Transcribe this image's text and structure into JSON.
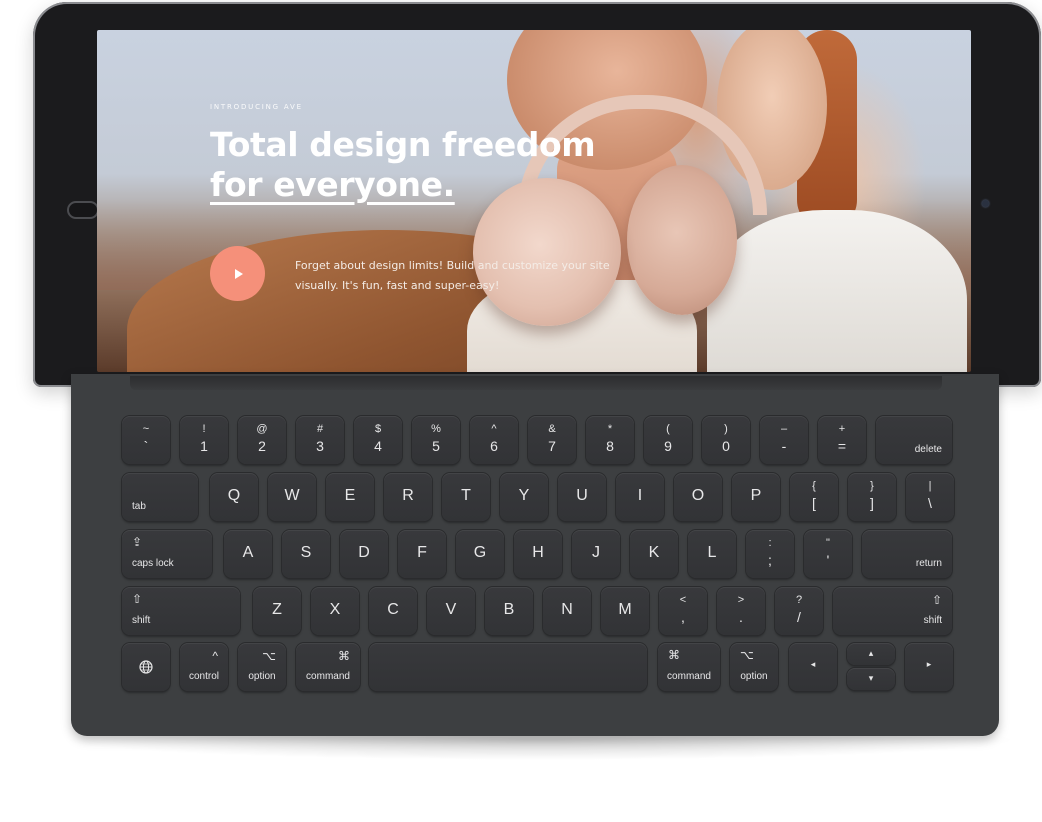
{
  "hero": {
    "eyebrow": "INTRODUCING AVE",
    "headline_line1": "Total design freedom",
    "headline_line2": "for everyone.",
    "description": "Forget about design limits! Build and customize your site visually. It's fun, fast and super-easy!",
    "play_icon": "play-icon",
    "accent_color": "#f5907a"
  },
  "keyboard": {
    "row1": [
      {
        "top": "~",
        "bottom": "`"
      },
      {
        "top": "!",
        "bottom": "1"
      },
      {
        "top": "@",
        "bottom": "2"
      },
      {
        "top": "#",
        "bottom": "3"
      },
      {
        "top": "$",
        "bottom": "4"
      },
      {
        "top": "%",
        "bottom": "5"
      },
      {
        "top": "^",
        "bottom": "6"
      },
      {
        "top": "&",
        "bottom": "7"
      },
      {
        "top": "*",
        "bottom": "8"
      },
      {
        "top": "(",
        "bottom": "9"
      },
      {
        "top": ")",
        "bottom": "0"
      },
      {
        "top": "–",
        "bottom": "-"
      },
      {
        "top": "+",
        "bottom": "="
      }
    ],
    "delete": "delete",
    "tab": "tab",
    "row2_letters": [
      "Q",
      "W",
      "E",
      "R",
      "T",
      "Y",
      "U",
      "I",
      "O",
      "P"
    ],
    "row2_symbols": [
      {
        "top": "{",
        "bottom": "["
      },
      {
        "top": "}",
        "bottom": "]"
      },
      {
        "top": "|",
        "bottom": "\\"
      }
    ],
    "caps_icon": "⇪",
    "caps_lock": "caps lock",
    "row3_letters": [
      "A",
      "S",
      "D",
      "F",
      "G",
      "H",
      "J",
      "K",
      "L"
    ],
    "row3_symbols": [
      {
        "top": ":",
        "bottom": ";"
      },
      {
        "top": "\"",
        "bottom": "'"
      }
    ],
    "return": "return",
    "shift_icon": "⇧",
    "shift": "shift",
    "row4_letters": [
      "Z",
      "X",
      "C",
      "V",
      "B",
      "N",
      "M"
    ],
    "row4_symbols": [
      {
        "top": "<",
        "bottom": ","
      },
      {
        "top": ">",
        "bottom": "."
      },
      {
        "top": "?",
        "bottom": "/"
      }
    ],
    "globe_icon": "globe-icon",
    "control_icon": "^",
    "control": "control",
    "option_icon": "⌥",
    "option": "option",
    "command_icon": "⌘",
    "command": "command",
    "arrow_left": "◂",
    "arrow_up": "▴",
    "arrow_down": "▾",
    "arrow_right": "▸"
  }
}
